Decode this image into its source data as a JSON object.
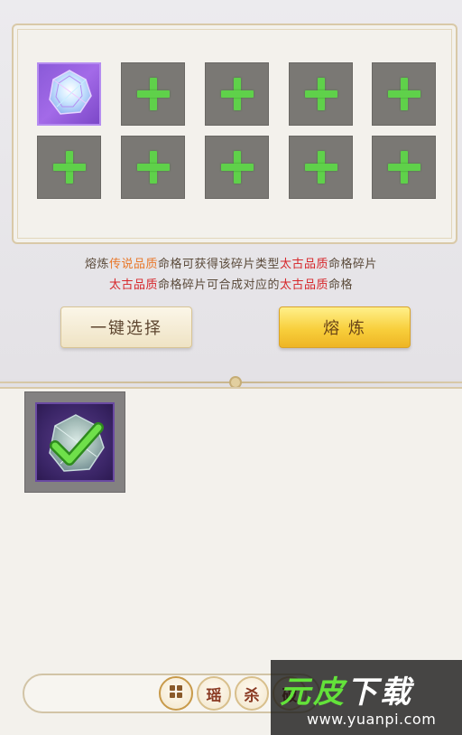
{
  "slots": {
    "filled_count": 1,
    "total": 10,
    "empty_icon": "plus-icon",
    "filled_icon": "crystal-shard-icon"
  },
  "info": {
    "line1": {
      "p1": "熔炼",
      "p2": "传说品质",
      "p3": "命格可获得该碎片类型",
      "p4": "太古品质",
      "p5": "命格碎片"
    },
    "line2": {
      "p1": "太古品质",
      "p2": "命格碎片可合成对应的",
      "p3": "太古品质",
      "p4": "命格"
    }
  },
  "buttons": {
    "select_label": "一键选择",
    "refine_label": "熔 炼"
  },
  "bag": {
    "item_icon": "crystal-shard-selected-icon",
    "check_icon": "checkmark-icon"
  },
  "tabs": [
    {
      "label": "",
      "icon": "grid-icon"
    },
    {
      "label": "瑶"
    },
    {
      "label": "杀"
    },
    {
      "label": "破"
    }
  ],
  "watermark": {
    "title_a": "元",
    "title_b": "皮",
    "title_c": "下载",
    "url": "www.yuanpi.com"
  },
  "colors": {
    "legend": "#e8782a",
    "ancient": "#d6262a",
    "plus": "#5fd14a",
    "refine_button": "#f8cf3c"
  }
}
